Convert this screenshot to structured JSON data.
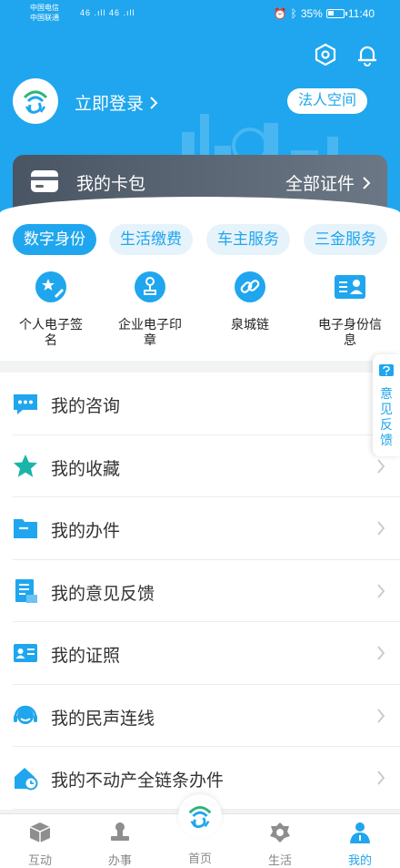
{
  "status_bar": {
    "carrier1": "中国电信",
    "carrier2": "中国联通",
    "signal": "46 .ıll 46 .ıll",
    "battery": "35%",
    "time": "11:40"
  },
  "header": {
    "login_label": "立即登录",
    "legal_space": "法人空间"
  },
  "wallet": {
    "title": "我的卡包",
    "all_certs": "全部证件"
  },
  "tabs": [
    {
      "label": "数字身份",
      "active": true
    },
    {
      "label": "生活缴费",
      "active": false
    },
    {
      "label": "车主服务",
      "active": false
    },
    {
      "label": "三金服务",
      "active": false
    }
  ],
  "services": [
    {
      "label": "个人电子签名",
      "icon": "signature-icon"
    },
    {
      "label": "企业电子印章",
      "icon": "seal-icon"
    },
    {
      "label": "泉城链",
      "icon": "chain-link-icon"
    },
    {
      "label": "电子身份信息",
      "icon": "id-card-icon"
    }
  ],
  "list": [
    {
      "label": "我的咨询",
      "icon": "chat-icon"
    },
    {
      "label": "我的收藏",
      "icon": "star-icon"
    },
    {
      "label": "我的办件",
      "icon": "folder-icon"
    },
    {
      "label": "我的意见反馈",
      "icon": "document-icon"
    },
    {
      "label": "我的证照",
      "icon": "license-icon"
    },
    {
      "label": "我的民声连线",
      "icon": "headset-icon"
    },
    {
      "label": "我的不动产全链条办件",
      "icon": "house-icon"
    }
  ],
  "feedback_tab": {
    "label": "意见反馈"
  },
  "tabbar": [
    {
      "label": "互动",
      "icon": "cube-icon",
      "active": false
    },
    {
      "label": "办事",
      "icon": "stamp-icon",
      "active": false
    },
    {
      "label": "首页",
      "icon": "home-logo-icon",
      "active": false
    },
    {
      "label": "生活",
      "icon": "flower-icon",
      "active": false
    },
    {
      "label": "我的",
      "icon": "person-icon",
      "active": true
    }
  ],
  "colors": {
    "primary": "#1fa6ee",
    "wallet_bg": "#4a5563",
    "list_icon": "#1fa6ee"
  }
}
